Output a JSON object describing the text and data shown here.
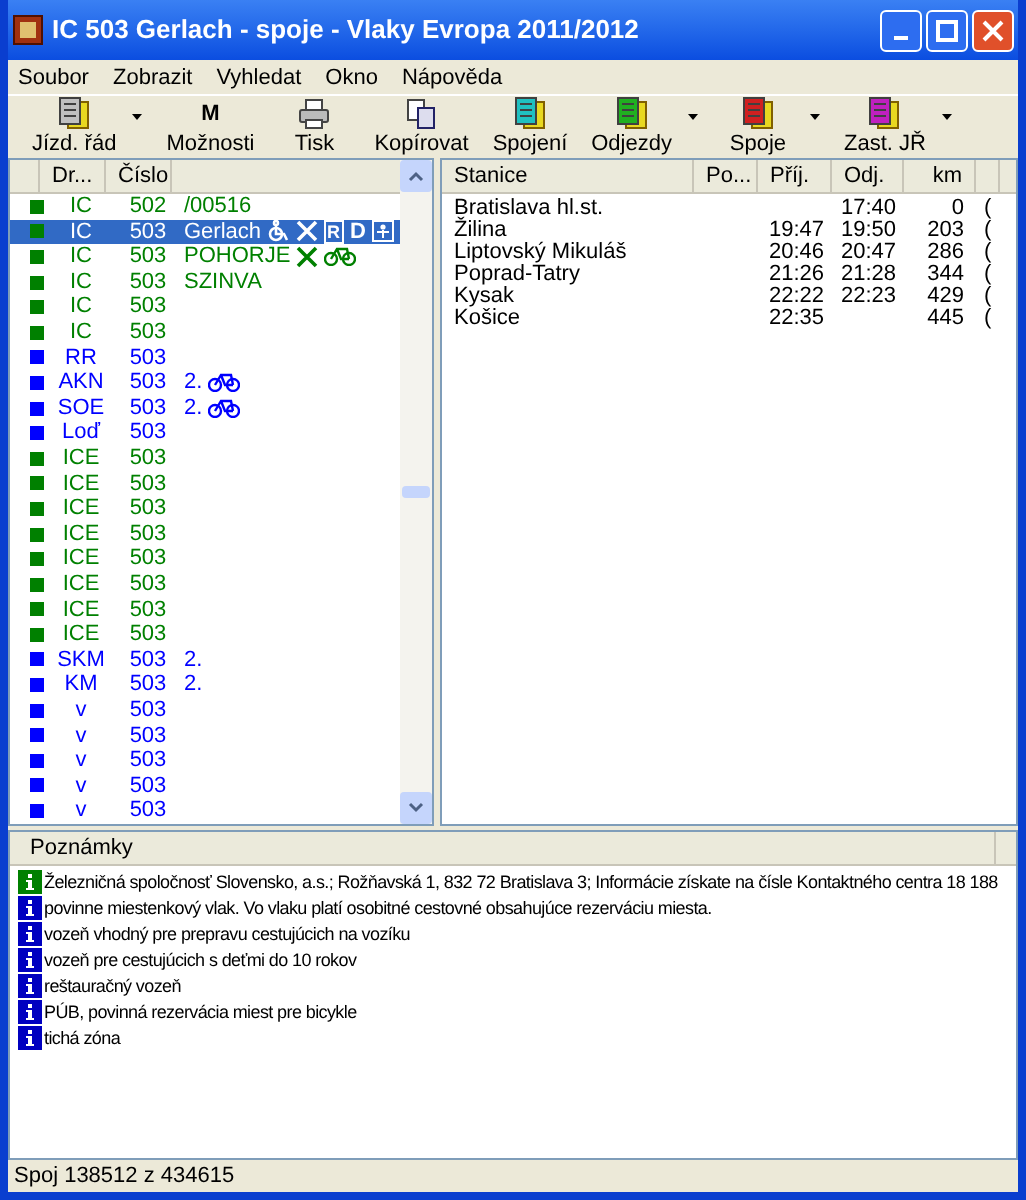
{
  "window": {
    "title": "IC 503 Gerlach - spoje - Vlaky Evropa 2011/2012"
  },
  "menu": [
    "Soubor",
    "Zobrazit",
    "Vyhledat",
    "Okno",
    "Nápověda"
  ],
  "toolbar": [
    {
      "label": "Jízd. řád",
      "kind": "doc",
      "color": "#c0c0c0",
      "dropdown": true
    },
    {
      "label": "Možnosti",
      "kind": "letter",
      "glyph": "M",
      "dropdown": false
    },
    {
      "label": "Tisk",
      "kind": "printer",
      "dropdown": false
    },
    {
      "label": "Kopírovat",
      "kind": "copy",
      "dropdown": false
    },
    {
      "label": "Spojení",
      "kind": "doc",
      "color": "#20c0c0",
      "dropdown": false
    },
    {
      "label": "Odjezdy",
      "kind": "doc",
      "color": "#20b020",
      "dropdown": true
    },
    {
      "label": "Spoje",
      "kind": "doc",
      "color": "#d02020",
      "dropdown": true
    },
    {
      "label": "Zast. JŘ",
      "kind": "doc",
      "color": "#c020c0",
      "dropdown": true
    }
  ],
  "trains": {
    "columns": [
      "Dr...",
      "Číslo"
    ],
    "rows": [
      {
        "type": "IC",
        "number": "502",
        "name": "/00516",
        "color": "#008000",
        "selected": false,
        "services": []
      },
      {
        "type": "IC",
        "number": "503",
        "name": "Gerlach",
        "color": "#008000",
        "selected": true,
        "services": [
          {
            "kind": "wheelchair"
          },
          {
            "kind": "restaurant"
          },
          {
            "kind": "boxed",
            "text": "R"
          },
          {
            "kind": "letter",
            "text": "D"
          },
          {
            "kind": "child"
          }
        ]
      },
      {
        "type": "IC",
        "number": "503",
        "name": "POHORJE",
        "color": "#008000",
        "selected": false,
        "services": [
          {
            "kind": "restaurant"
          },
          {
            "kind": "bicycle"
          }
        ]
      },
      {
        "type": "IC",
        "number": "503",
        "name": "SZINVA",
        "color": "#008000",
        "selected": false,
        "services": []
      },
      {
        "type": "IC",
        "number": "503",
        "color": "#008000",
        "selected": false,
        "services": []
      },
      {
        "type": "IC",
        "number": "503",
        "color": "#008000",
        "selected": false,
        "services": []
      },
      {
        "type": "RR",
        "number": "503",
        "color": "#0000ff",
        "selected": false,
        "services": []
      },
      {
        "type": "AKN",
        "number": "503",
        "color": "#0000ff",
        "selected": false,
        "services": [
          {
            "kind": "letter",
            "text": "2."
          },
          {
            "kind": "bicycle"
          }
        ]
      },
      {
        "type": "SOE",
        "number": "503",
        "color": "#0000ff",
        "selected": false,
        "services": [
          {
            "kind": "letter",
            "text": "2."
          },
          {
            "kind": "bicycle"
          }
        ]
      },
      {
        "type": "Loď",
        "number": "503",
        "color": "#0000ff",
        "selected": false,
        "services": []
      },
      {
        "type": "ICE",
        "number": "503",
        "color": "#008000",
        "selected": false,
        "services": []
      },
      {
        "type": "ICE",
        "number": "503",
        "color": "#008000",
        "selected": false,
        "services": []
      },
      {
        "type": "ICE",
        "number": "503",
        "color": "#008000",
        "selected": false,
        "services": []
      },
      {
        "type": "ICE",
        "number": "503",
        "color": "#008000",
        "selected": false,
        "services": []
      },
      {
        "type": "ICE",
        "number": "503",
        "color": "#008000",
        "selected": false,
        "services": []
      },
      {
        "type": "ICE",
        "number": "503",
        "color": "#008000",
        "selected": false,
        "services": []
      },
      {
        "type": "ICE",
        "number": "503",
        "color": "#008000",
        "selected": false,
        "services": []
      },
      {
        "type": "ICE",
        "number": "503",
        "color": "#008000",
        "selected": false,
        "services": []
      },
      {
        "type": "SKM",
        "number": "503",
        "color": "#0000ff",
        "selected": false,
        "services": [
          {
            "kind": "letter",
            "text": "2."
          }
        ]
      },
      {
        "type": "KM",
        "number": "503",
        "color": "#0000ff",
        "selected": false,
        "services": [
          {
            "kind": "letter",
            "text": "2."
          }
        ]
      },
      {
        "type": "v",
        "number": "503",
        "color": "#0000ff",
        "selected": false,
        "services": []
      },
      {
        "type": "v",
        "number": "503",
        "color": "#0000ff",
        "selected": false,
        "services": []
      },
      {
        "type": "v",
        "number": "503",
        "color": "#0000ff",
        "selected": false,
        "services": []
      },
      {
        "type": "v",
        "number": "503",
        "color": "#0000ff",
        "selected": false,
        "services": []
      },
      {
        "type": "v",
        "number": "503",
        "color": "#0000ff",
        "selected": false,
        "services": []
      }
    ]
  },
  "stops": {
    "columns": [
      "Stanice",
      "Po...",
      "Příj.",
      "Odj.",
      "km"
    ],
    "rows": [
      {
        "station": "Bratislava hl.st.",
        "departure": "17:40",
        "km": "0",
        "column_6": "("
      },
      {
        "station": "Žilina",
        "arrival": "19:47",
        "departure": "19:50",
        "km": "203",
        "column_6": "("
      },
      {
        "station": "Liptovský Mikuláš",
        "arrival": "20:46",
        "departure": "20:47",
        "km": "286",
        "column_6": "("
      },
      {
        "station": "Poprad-Tatry",
        "arrival": "21:26",
        "departure": "21:28",
        "km": "344",
        "column_6": "("
      },
      {
        "station": "Kysak",
        "arrival": "22:22",
        "departure": "22:23",
        "km": "429",
        "column_6": "("
      },
      {
        "station": "Košice",
        "arrival": "22:35",
        "km": "445",
        "column_6": "("
      }
    ]
  },
  "notes": {
    "title": "Poznámky",
    "items": [
      {
        "text": "Železničná spoločnosť Slovensko, a.s.; Rožňavská 1, 832 72 Bratislava 3; Informácie získate na čísle Kontaktného centra 18 188",
        "color": "#008000"
      },
      {
        "text": "povinne miestenkový vlak. Vo vlaku platí osobitné cestovné obsahujúce rezerváciu miesta.",
        "color": "#0000c0"
      },
      {
        "text": "vozeň vhodný pre prepravu cestujúcich na vozíku",
        "color": "#0000c0"
      },
      {
        "text": "vozeň pre cestujúcich s deťmi do 10 rokov",
        "color": "#0000c0"
      },
      {
        "text": "reštauračný vozeň",
        "color": "#0000c0"
      },
      {
        "text": "PÚB, povinná rezervácia miest pre bicykle",
        "color": "#0000c0"
      },
      {
        "text": "tichá zóna",
        "color": "#0000c0"
      }
    ]
  },
  "status_bar": "Spoj 138512 z 434615"
}
